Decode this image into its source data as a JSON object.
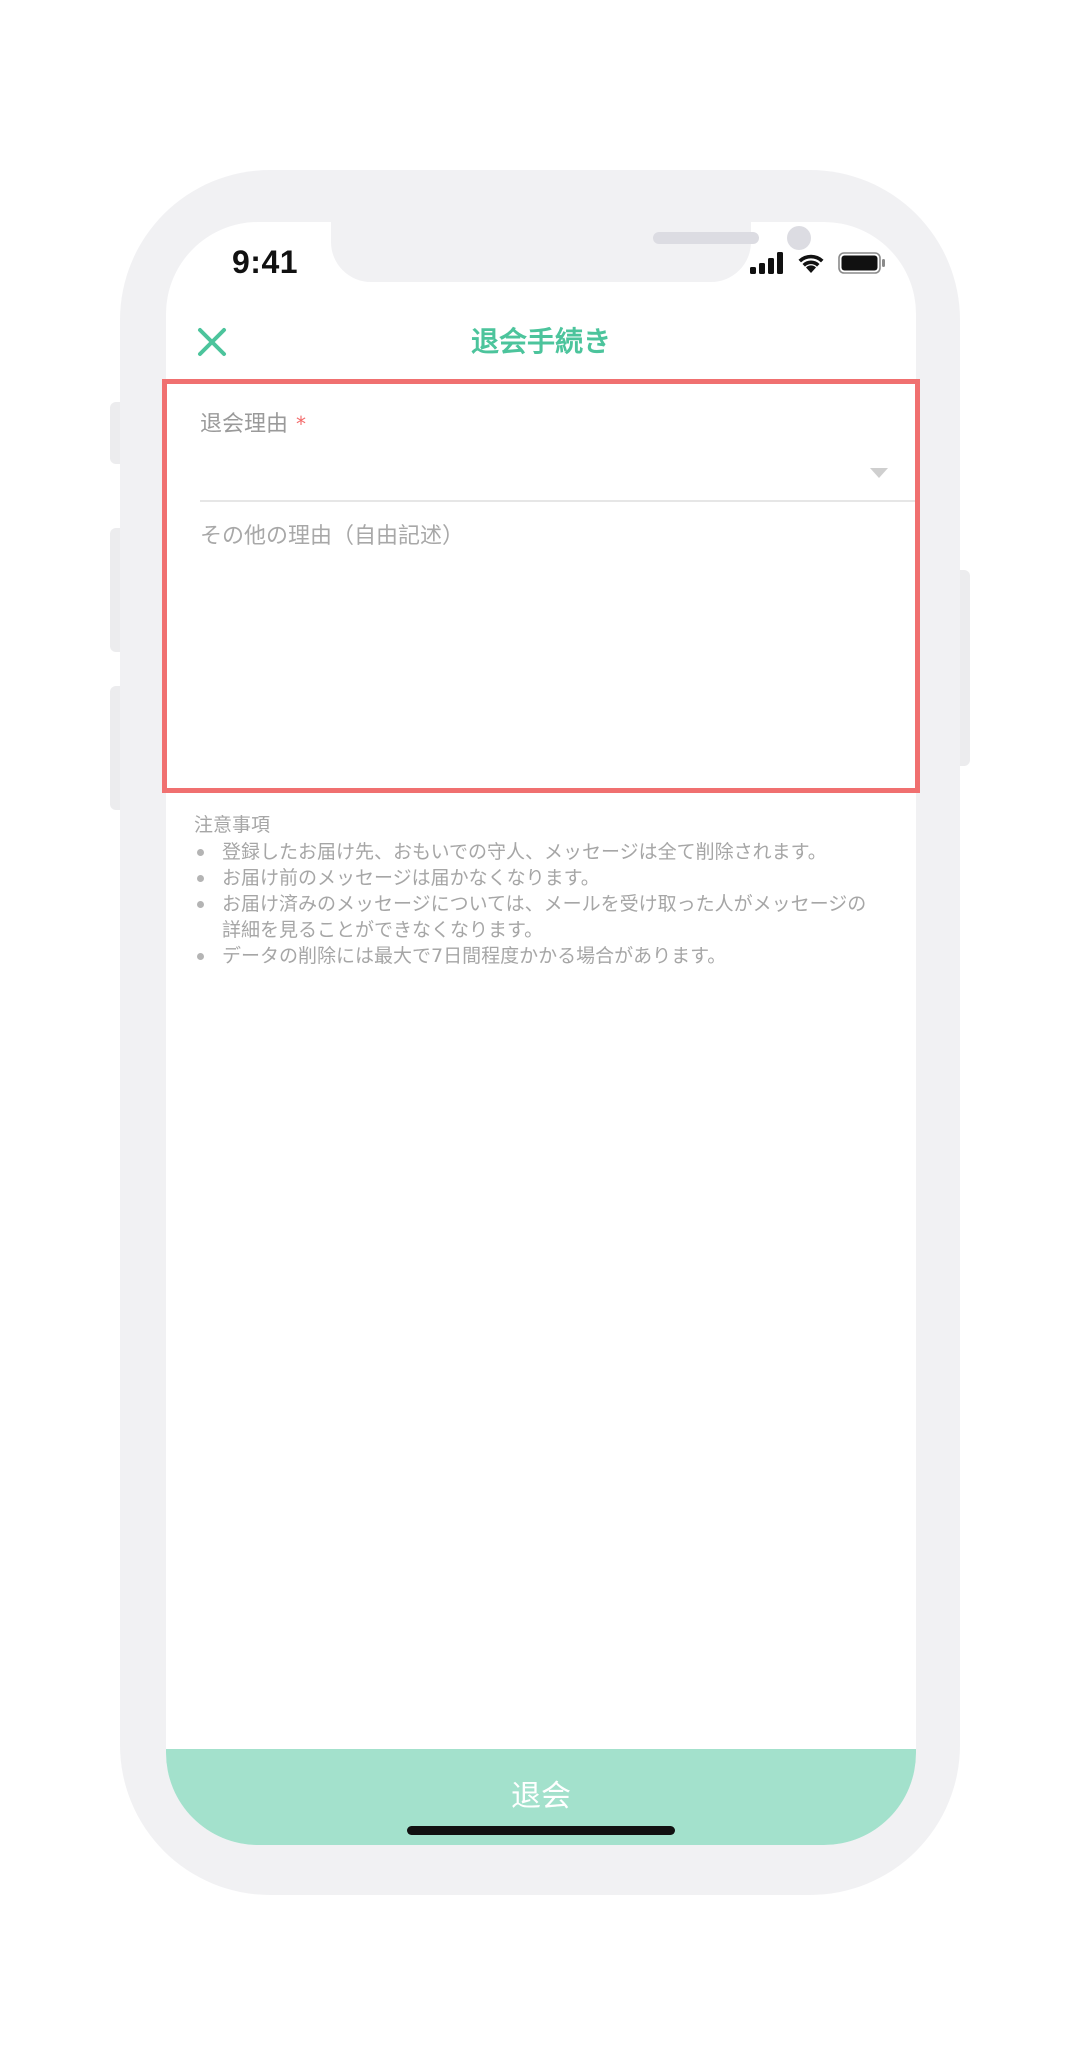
{
  "status_bar": {
    "time": "9:41",
    "icons": [
      "signal-icon",
      "wifi-icon",
      "battery-icon"
    ]
  },
  "nav": {
    "title": "退会手続き",
    "close_icon": "close-icon"
  },
  "form": {
    "reason_label": "退会理由",
    "required_mark": "*",
    "reason_selected": "",
    "other_placeholder": "その他の理由（自由記述）"
  },
  "notes": {
    "title": "注意事項",
    "items": [
      "登録したお届け先、おもいでの守人、メッセージは全て削除されます。",
      "お届け前のメッセージは届かなくなります。",
      "お届け済みのメッセージについては、メールを受け取った人がメッセージの詳細を見ることができなくなります。",
      "データの削除には最大で7日間程度かかる場合があります。"
    ]
  },
  "footer": {
    "withdraw_label": "退会"
  },
  "colors": {
    "accent": "#4cc49c",
    "button": "#a3e1cc",
    "required": "#f36a6a",
    "highlight": "#f07070"
  }
}
